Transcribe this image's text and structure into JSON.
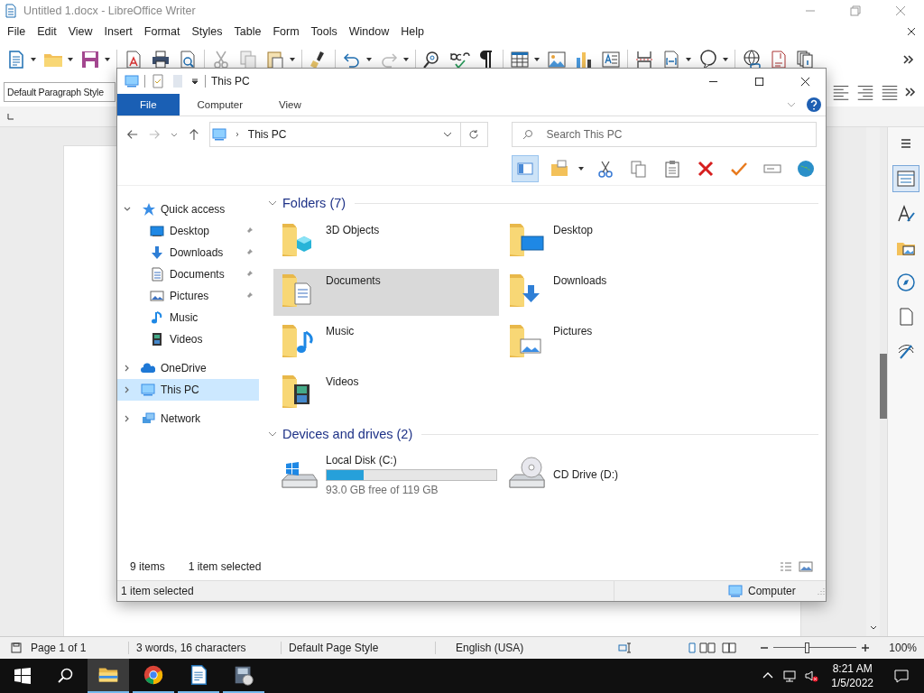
{
  "writer": {
    "title": "Untitled 1.docx - LibreOffice Writer",
    "menu": [
      "File",
      "Edit",
      "View",
      "Insert",
      "Format",
      "Styles",
      "Table",
      "Form",
      "Tools",
      "Window",
      "Help"
    ],
    "paragraph_style": "Default Paragraph Style",
    "status_bar": {
      "page": "Page 1 of 1",
      "words": "3 words, 16 characters",
      "page_style": "Default Page Style",
      "language": "English (USA)",
      "zoom": {
        "level": 0.4,
        "reading": "100%"
      }
    }
  },
  "explorer": {
    "title": "This PC",
    "tabs": [
      {
        "label": "File",
        "selected": true
      },
      {
        "label": "Computer",
        "selected": false
      },
      {
        "label": "View",
        "selected": false
      }
    ],
    "address": "This PC",
    "search": {
      "placeholder": "Search This PC"
    },
    "navigation": [
      {
        "label": "Quick access",
        "kind": "star",
        "expanded": true,
        "selected": false,
        "children": [
          {
            "label": "Desktop",
            "kind": "desktop",
            "pinned": true,
            "selected": false
          },
          {
            "label": "Downloads",
            "kind": "downloads",
            "pinned": true,
            "selected": false
          },
          {
            "label": "Documents",
            "kind": "documents",
            "pinned": true,
            "selected": false
          },
          {
            "label": "Pictures",
            "kind": "pictures",
            "pinned": true,
            "selected": false
          },
          {
            "label": "Music",
            "kind": "music",
            "pinned": false,
            "selected": false
          },
          {
            "label": "Videos",
            "kind": "videos",
            "pinned": false,
            "selected": false
          }
        ]
      },
      {
        "label": "OneDrive",
        "kind": "cloud",
        "expanded": false,
        "selected": false
      },
      {
        "label": "This PC",
        "kind": "pc",
        "expanded": false,
        "selected": true
      },
      {
        "label": "Network",
        "kind": "network",
        "expanded": false,
        "selected": false
      }
    ],
    "groups": [
      {
        "title": "Folders (7)",
        "expanded": true,
        "items": [
          {
            "name": "3D Objects",
            "kind": "objects",
            "selected": false
          },
          {
            "name": "Desktop",
            "kind": "desktop",
            "selected": false
          },
          {
            "name": "Documents",
            "kind": "documents",
            "selected": true
          },
          {
            "name": "Downloads",
            "kind": "downloads",
            "selected": false
          },
          {
            "name": "Music",
            "kind": "music",
            "selected": false
          },
          {
            "name": "Pictures",
            "kind": "pictures",
            "selected": false
          },
          {
            "name": "Videos",
            "kind": "videos",
            "selected": false
          }
        ]
      },
      {
        "title": "Devices and drives (2)",
        "expanded": true,
        "items": [
          {
            "name": "Local Disk (C:)",
            "kind": "disk",
            "level": 0.22,
            "free": "93.0 GB free of 119 GB",
            "selected": false
          },
          {
            "name": "CD Drive (D:)",
            "kind": "cd",
            "selected": false
          }
        ]
      }
    ],
    "item_count": "9 items",
    "selection_count": "1 item selected",
    "status_bar": {
      "text": "1 item selected",
      "location": "Computer"
    }
  },
  "taskbar": {
    "apps": [
      {
        "kind": "explorer",
        "selected": true
      },
      {
        "kind": "browser",
        "selected": false
      },
      {
        "kind": "writer",
        "selected": false
      },
      {
        "kind": "video",
        "selected": false
      }
    ],
    "time": "8:21 AM",
    "date": "1/5/2022"
  }
}
